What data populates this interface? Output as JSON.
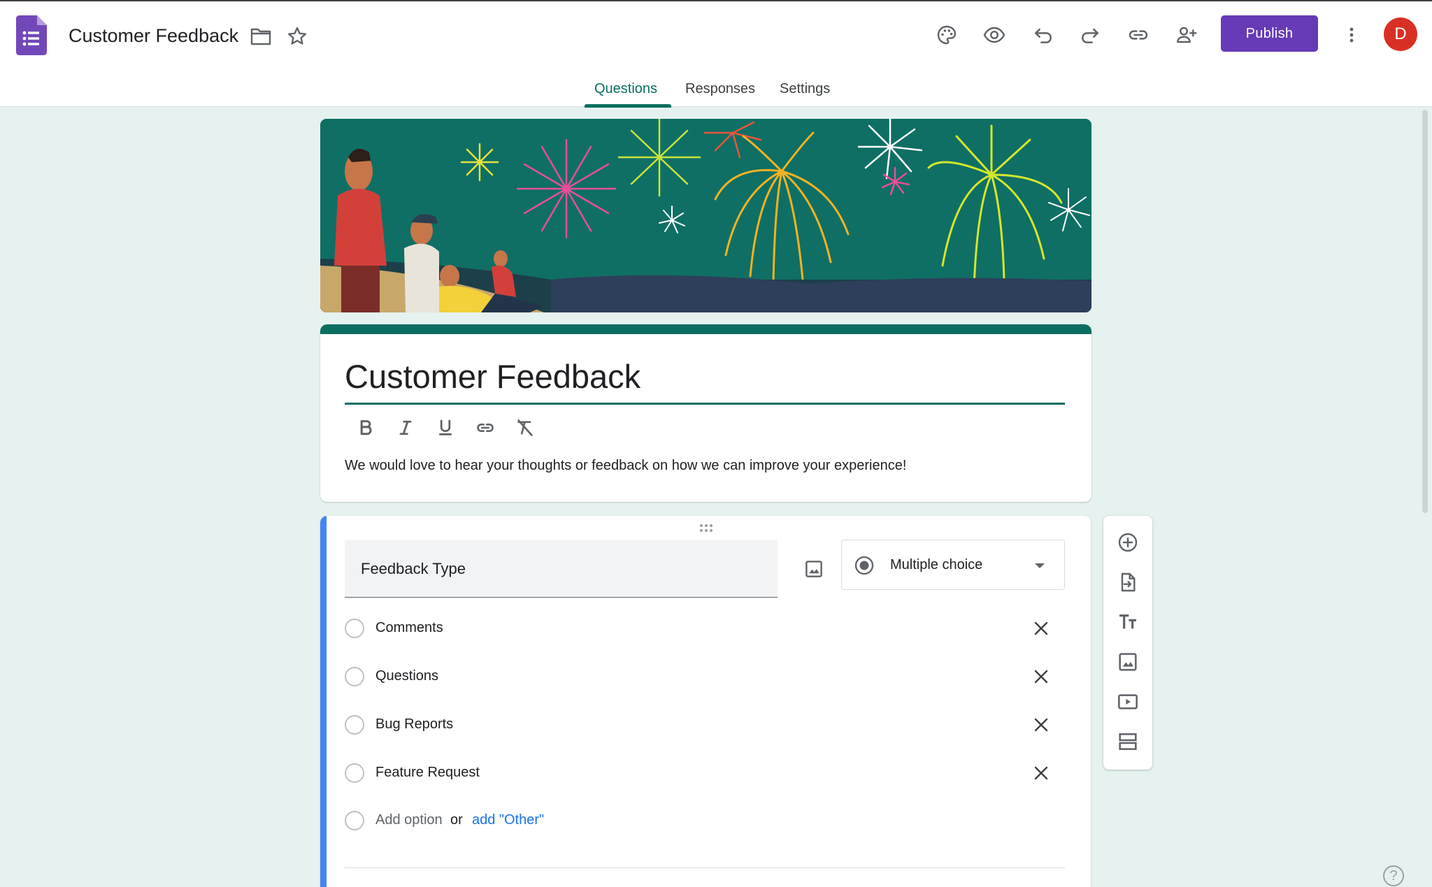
{
  "app": {
    "doc_title": "Customer Feedback",
    "publish_label": "Publish",
    "avatar_initial": "D",
    "brand_color": "#673ab7",
    "theme_color": "#0b6e60",
    "accent_color": "#4285f4",
    "toolbar_icons": [
      "palette-icon",
      "preview-icon",
      "undo-icon",
      "redo-icon",
      "link-icon",
      "add-collaborator-icon",
      "more-vert-icon"
    ]
  },
  "tabs": [
    {
      "label": "Questions",
      "active": true
    },
    {
      "label": "Responses",
      "active": false
    },
    {
      "label": "Settings",
      "active": false
    }
  ],
  "form": {
    "title": "Customer Feedback",
    "description": "We would love to hear your thoughts or feedback on how we can improve your experience!",
    "format_icons": [
      "bold-icon",
      "italic-icon",
      "underline-icon",
      "link-icon",
      "clear-format-icon"
    ]
  },
  "question": {
    "title": "Feedback Type",
    "type": "Multiple choice",
    "options": [
      "Comments",
      "Questions",
      "Bug Reports",
      "Feature Request"
    ],
    "add_option": "Add option",
    "or_text": "or",
    "add_other": "add \"Other\""
  },
  "side_toolbar": [
    "add-question-icon",
    "import-questions-icon",
    "add-title-icon",
    "add-image-icon",
    "add-video-icon",
    "add-section-icon"
  ],
  "help": "?"
}
